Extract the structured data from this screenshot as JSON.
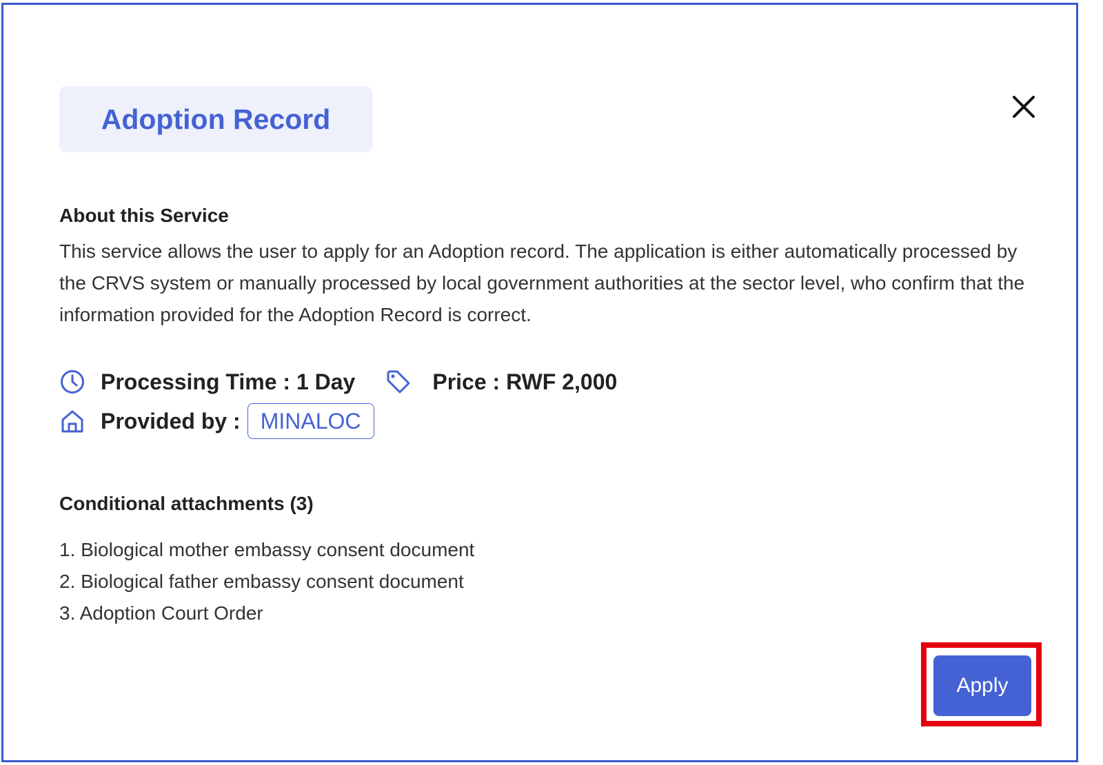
{
  "dialog": {
    "title": "Adoption Record",
    "close_icon": "close-icon"
  },
  "about": {
    "heading": "About this Service",
    "body": "This service allows the user to apply for an Adoption record. The application is either automatically processed by the CRVS system or manually processed by local government authorities at the sector level, who confirm that the information provided for the Adoption Record is correct."
  },
  "meta": {
    "processing_icon": "clock-icon",
    "processing_label": "Processing Time : 1 Day",
    "price_icon": "tag-icon",
    "price_label": "Price : RWF 2,000",
    "provider_icon": "home-icon",
    "provider_label": "Provided by :",
    "provider_name": "MINALOC"
  },
  "attachments": {
    "heading": "Conditional attachments (3)",
    "items": [
      "1. Biological mother embassy consent document",
      "2. Biological father embassy consent document",
      "3. Adoption Court Order"
    ]
  },
  "actions": {
    "apply_label": "Apply"
  },
  "colors": {
    "accent": "#4562d4",
    "badge_bg": "#eef1fb",
    "highlight": "#e4000f",
    "border": "#3b58cf"
  }
}
